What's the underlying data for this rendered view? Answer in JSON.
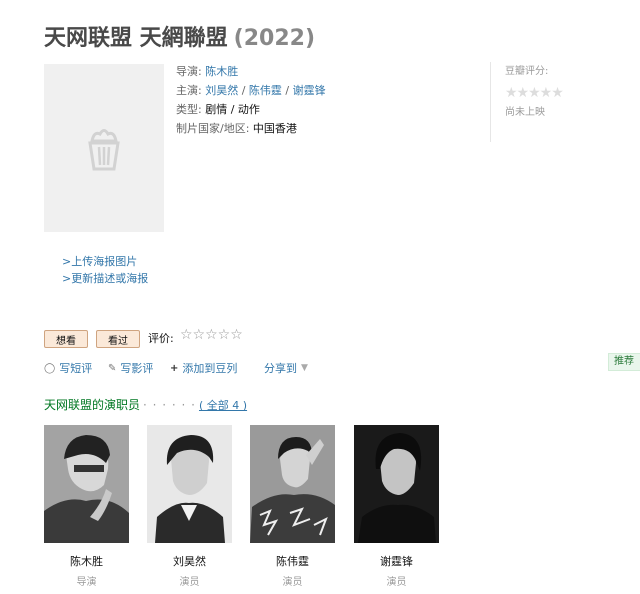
{
  "header": {
    "title": "天网联盟 天網聯盟",
    "year": "(2022)"
  },
  "info": {
    "director_label": "导演:",
    "director": "陈木胜",
    "starring_label": "主演:",
    "starring": [
      "刘昊然",
      "陈伟霆",
      "谢霆锋"
    ],
    "separator": " / ",
    "genre_label": "类型:",
    "genres": [
      "剧情",
      "动作"
    ],
    "region_label": "制片国家/地区:",
    "region": "中国香港"
  },
  "rating": {
    "label": "豆瓣评分:",
    "stars": "★★★★★",
    "status": "尚未上映"
  },
  "poster": {
    "upload": ">上传海报图片",
    "update": ">更新描述或海报"
  },
  "actions": {
    "want": "想看",
    "seen": "看过",
    "rate_label": "评价:",
    "rate_stars": "☆☆☆☆☆"
  },
  "links": {
    "short_review": "写短评",
    "review": "写影评",
    "add_doulist": "添加到豆列",
    "share": "分享到"
  },
  "recommend": "推荐",
  "cast": {
    "heading": "天网联盟的演职员",
    "dots": "· · · · · ·",
    "all": "( 全部 4 )",
    "people": [
      {
        "name": "陈木胜",
        "role": "导演"
      },
      {
        "name": "刘昊然",
        "role": "演员"
      },
      {
        "name": "陈伟霆",
        "role": "演员"
      },
      {
        "name": "谢霆锋",
        "role": "演员"
      }
    ]
  },
  "colors": {
    "link": "#3377aa",
    "green": "#007722",
    "button_bg": "#fbe9d9"
  }
}
